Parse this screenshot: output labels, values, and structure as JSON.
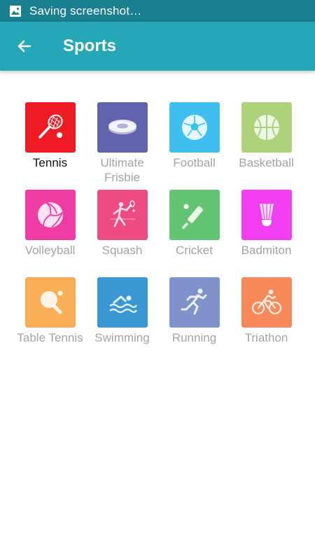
{
  "status_bar": {
    "text": "Saving screenshot…",
    "icon": "image-icon"
  },
  "app_bar": {
    "title": "Sports",
    "back_icon": "arrow-left-icon"
  },
  "sports": [
    {
      "label": "Tennis",
      "icon": "tennis-racket-icon",
      "color": "#ee1b24",
      "selected": true
    },
    {
      "label": "Ultimate Frisbie",
      "icon": "frisbee-icon",
      "color": "#6164ad",
      "selected": false
    },
    {
      "label": "Football",
      "icon": "soccer-ball-icon",
      "color": "#3fbff0",
      "selected": false
    },
    {
      "label": "Basketball",
      "icon": "basketball-icon",
      "color": "#acd37c",
      "selected": false
    },
    {
      "label": "Volleyball",
      "icon": "volleyball-icon",
      "color": "#ee3ca3",
      "selected": false
    },
    {
      "label": "Squash",
      "icon": "squash-player-icon",
      "color": "#ee4b82",
      "selected": false
    },
    {
      "label": "Cricket",
      "icon": "cricket-bat-icon",
      "color": "#63c573",
      "selected": false
    },
    {
      "label": "Badmiton",
      "icon": "shuttlecock-icon",
      "color": "#f13ef2",
      "selected": false
    },
    {
      "label": "Table Tennis",
      "icon": "ping-pong-paddle-icon",
      "color": "#f9af57",
      "selected": false
    },
    {
      "label": "Swimming",
      "icon": "swimmer-icon",
      "color": "#3a97d3",
      "selected": false
    },
    {
      "label": "Running",
      "icon": "runner-icon",
      "color": "#7f92cc",
      "selected": false
    },
    {
      "label": "Triathon",
      "icon": "cyclist-icon",
      "color": "#f7895a",
      "selected": false
    }
  ]
}
